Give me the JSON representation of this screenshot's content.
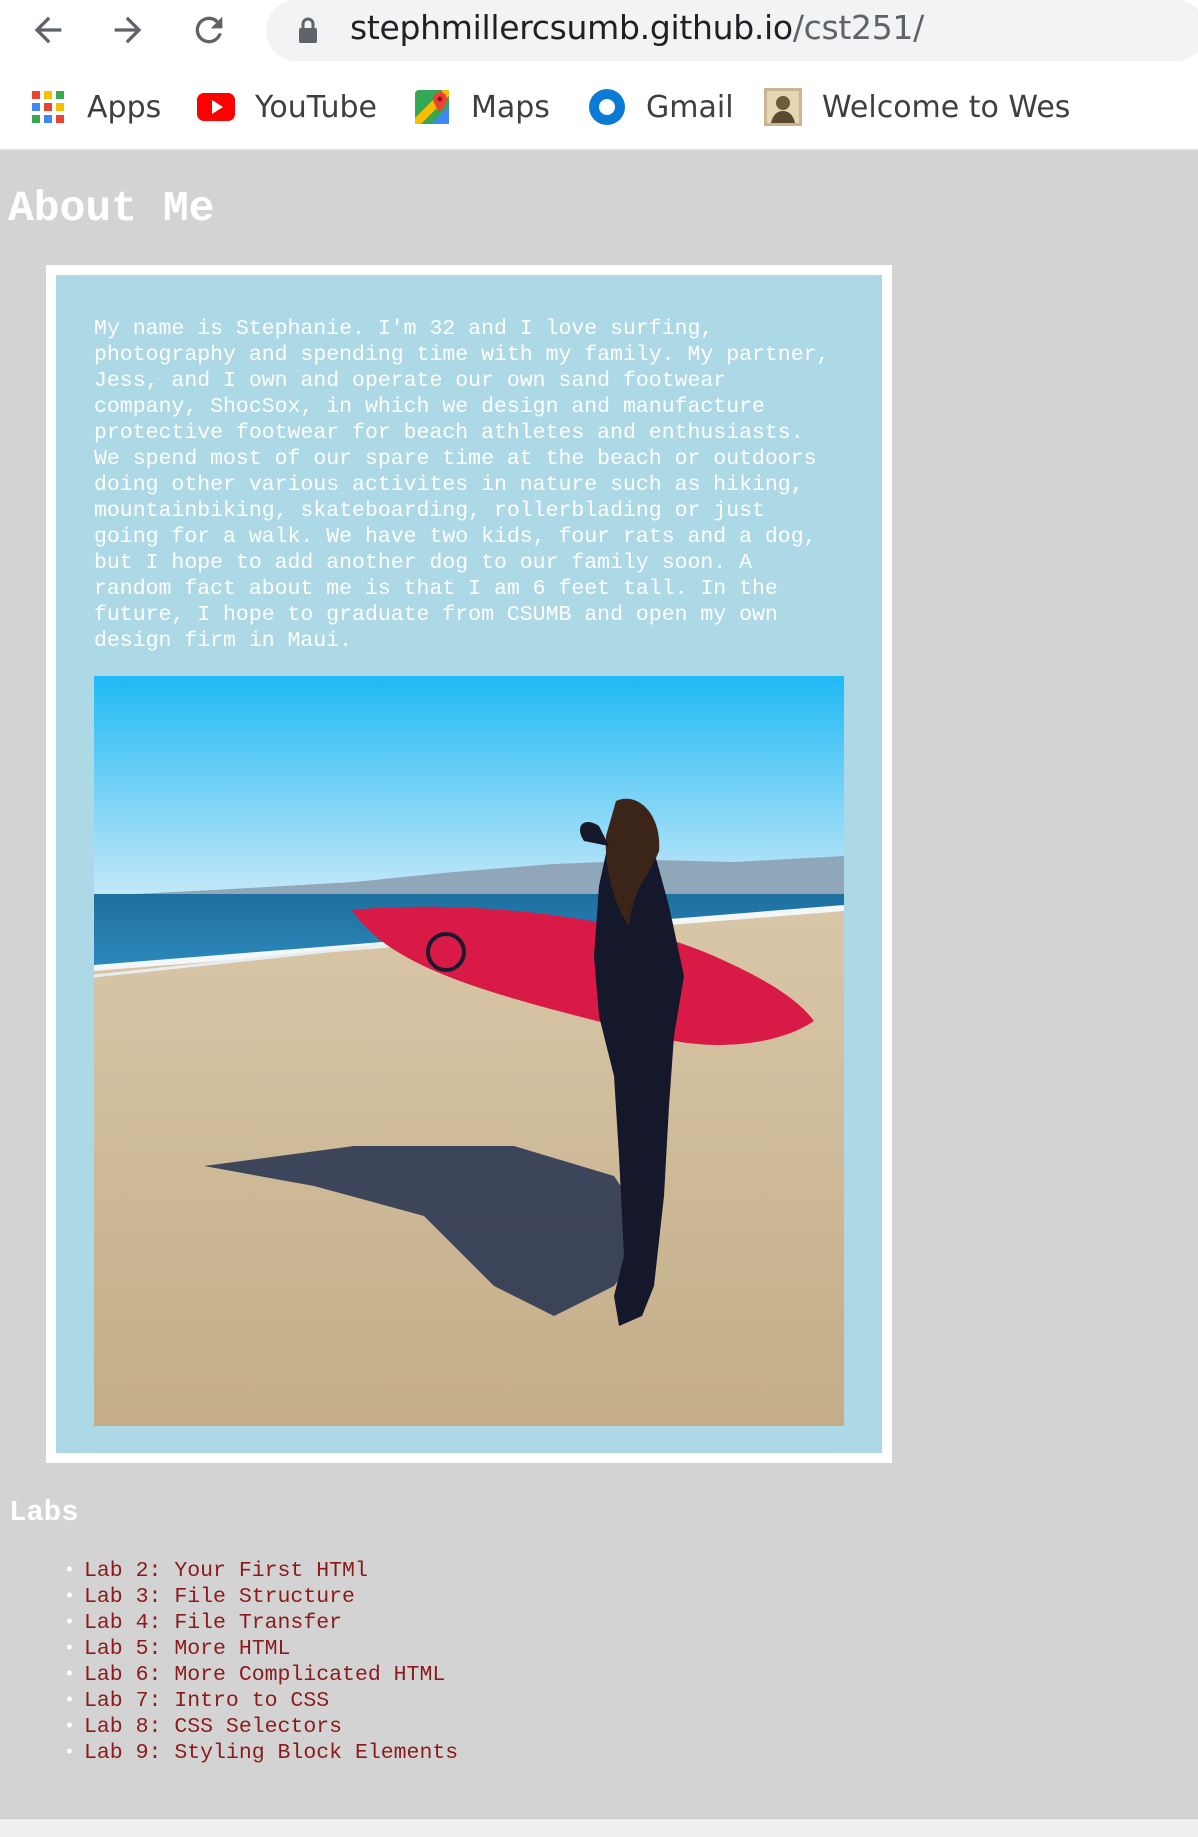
{
  "browser": {
    "url_host": "stephmillercsumb.github.io",
    "url_path": "/cst251/",
    "bookmarks": [
      {
        "label": "Apps",
        "icon": "apps-grid-icon"
      },
      {
        "label": "YouTube",
        "icon": "youtube-icon"
      },
      {
        "label": "Maps",
        "icon": "maps-icon"
      },
      {
        "label": "Gmail",
        "icon": "gmail-icon"
      },
      {
        "label": "Welcome to Wes",
        "icon": "site-favicon-icon"
      }
    ]
  },
  "page": {
    "title": "About Me",
    "bio": "My name is Stephanie. I'm 32 and I love surfing, photography and spending time with my family. My partner, Jess, and I own and operate our own sand footwear company, ShocSox, in which we design and manufacture protective footwear for beach athletes and enthusiasts. We spend most of our spare time at the beach or outdoors doing other various activites in nature such as hiking, mountainbiking, skateboarding, rollerblading or just going for a walk. We have two kids, four rats and a dog, but I hope to add another dog to our family soon. A random fact about me is that I am 6 feet tall. In the future, I hope to graduate from CSUMB and open my own design firm in Maui.",
    "labs_title": "Labs",
    "labs": [
      "Lab 2: Your First HTMl",
      "Lab 3: File Structure",
      "Lab 4: File Transfer",
      "Lab 5: More HTML",
      "Lab 6: More Complicated HTML",
      "Lab 7: Intro to CSS",
      "Lab 8: CSS Selectors",
      "Lab 9: Styling Block Elements"
    ]
  },
  "colors": {
    "page_background": "#d3d3d3",
    "card_background": "#add8e6",
    "link": "#8b1a1a"
  }
}
